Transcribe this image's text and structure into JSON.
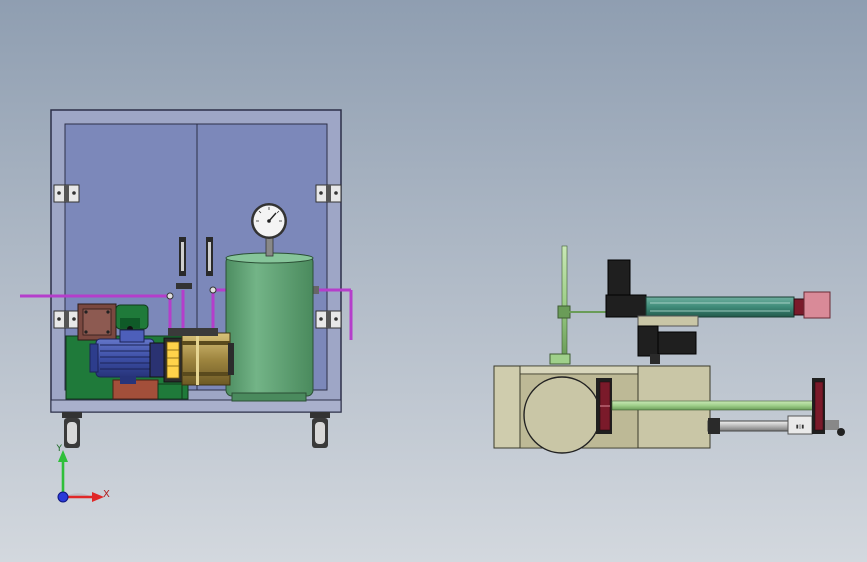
{
  "colors": {
    "bg_top": "#8f9eb1",
    "bg_bottom": "#d3d8de",
    "cabinet_glass": "#7c88ba",
    "cabinet_frame": "#9ea6c6",
    "tank": "#5e9f72",
    "motor": "#3d4fa6",
    "base_green": "#1f7a3a",
    "base_brown": "#a34f3a",
    "pipe": "#b53ecb",
    "rail_green": "#9fd08a",
    "block_tan": "#c9c6a6",
    "dark": "#1f1f1f",
    "crimson": "#7a1a2a",
    "pink": "#d98a98"
  },
  "scene": {
    "front_view": {
      "name": "hydraulic-pump-cabinet"
    },
    "side_view": {
      "name": "clamping-cylinder-assembly"
    },
    "axes": {
      "y_label": "Y",
      "x_label": "X"
    }
  },
  "icons": [
    "pressure-gauge-icon",
    "hinge-icon",
    "caster-wheel-icon",
    "axis-triad-icon"
  ]
}
